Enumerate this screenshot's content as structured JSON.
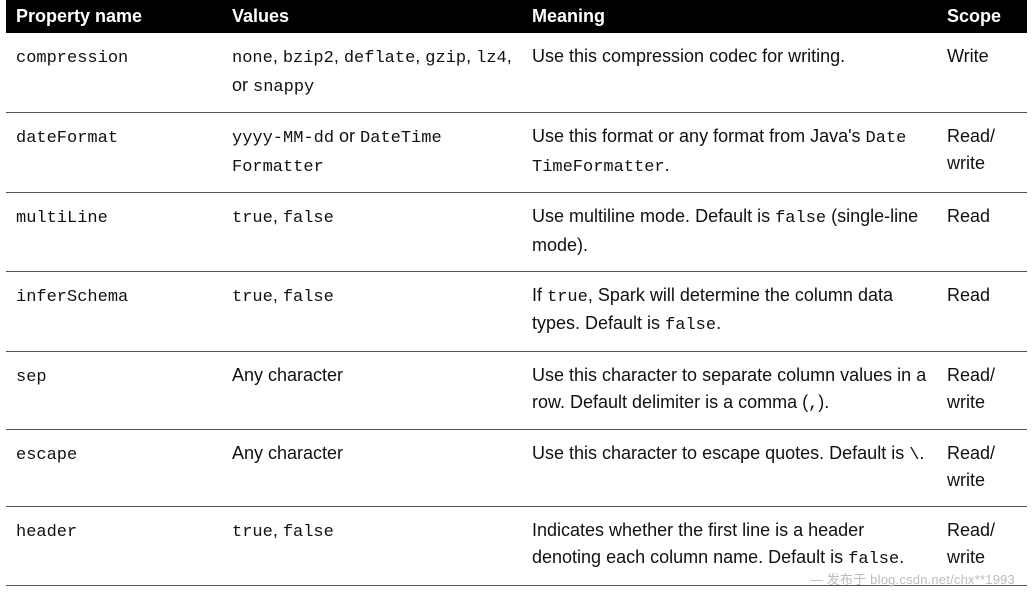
{
  "table": {
    "headers": [
      "Property name",
      "Values",
      "Meaning",
      "Scope"
    ],
    "rows": [
      {
        "property": "compression",
        "values_pre": "none",
        "values_mid1": ", ",
        "values_code2": "bzip2",
        "values_mid2": ", ",
        "values_code3": "deflate",
        "values_mid3": ", ",
        "values_code4": "gzip",
        "values_mid4": ", ",
        "values_code5": "lz4",
        "values_mid5": ", or ",
        "values_code6": "snappy",
        "meaning": "Use this compression codec for writing.",
        "scope": "Write"
      },
      {
        "property": "dateFormat",
        "values_code1": "yyyy-MM-dd",
        "values_mid1": " or ",
        "values_code2": "DateTime Formatter",
        "meaning_a": "Use this format or any format from Java's ",
        "meaning_code1": "Date TimeFormatter",
        "meaning_b": ".",
        "scope": "Read/ write"
      },
      {
        "property": "multiLine",
        "values_code1": "true",
        "values_mid1": ", ",
        "values_code2": "false",
        "meaning_a": "Use multiline mode. Default is ",
        "meaning_code1": "false",
        "meaning_b": " (single-line mode).",
        "scope": "Read"
      },
      {
        "property": "inferSchema",
        "values_code1": "true",
        "values_mid1": ", ",
        "values_code2": "false",
        "meaning_a": "If ",
        "meaning_code1": "true",
        "meaning_b": ", Spark will determine the column data types. Default is ",
        "meaning_code2": "false",
        "meaning_c": ".",
        "scope": "Read"
      },
      {
        "property": "sep",
        "values_plain": "Any character",
        "meaning_a": "Use this character to separate column values in a row. Default delimiter is a comma (",
        "meaning_code1": ",",
        "meaning_b": ").",
        "scope": "Read/ write"
      },
      {
        "property": "escape",
        "values_plain": "Any character",
        "meaning_a": "Use this character to escape quotes. Default is ",
        "meaning_code1": "\\",
        "meaning_b": ".",
        "scope": "Read/ write"
      },
      {
        "property": "header",
        "values_code1": "true",
        "values_mid1": ", ",
        "values_code2": "false",
        "meaning_a": "Indicates whether the first line is a header denoting each column name. Default is ",
        "meaning_code1": "false",
        "meaning_b": ".",
        "scope": "Read/ write"
      }
    ]
  },
  "watermark": "— 发布于 blog.csdn.net/chx**1993"
}
